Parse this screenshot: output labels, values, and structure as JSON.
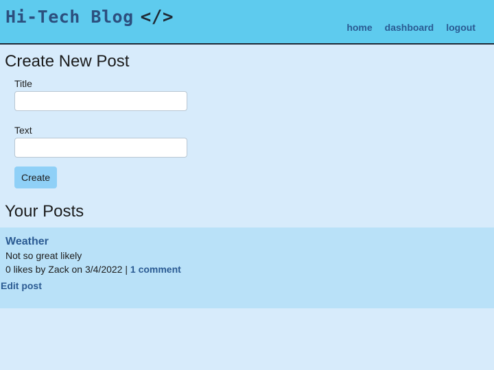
{
  "header": {
    "brand": "Hi-Tech Blog",
    "brand_icon": "</>",
    "nav": [
      "home",
      "dashboard",
      "logout"
    ]
  },
  "create_post": {
    "heading": "Create New Post",
    "title_label": "Title",
    "title_value": "",
    "text_label": "Text",
    "text_value": "",
    "submit_label": "Create"
  },
  "your_posts": {
    "heading": "Your Posts",
    "posts": [
      {
        "title": "Weather",
        "body": "Not so great likely",
        "likes": "0 likes",
        "by": "by",
        "author": "Zack",
        "on": "on",
        "date": "3/4/2022",
        "separator": "|",
        "comments": "1 comment",
        "edit_label": "Edit post"
      }
    ]
  },
  "colors": {
    "header_bg": "#5ecbee",
    "page_bg": "#d7ebfb",
    "card_bg": "#b9e1f8",
    "link": "#2a5a92",
    "button_bg": "#8fd0f7"
  }
}
